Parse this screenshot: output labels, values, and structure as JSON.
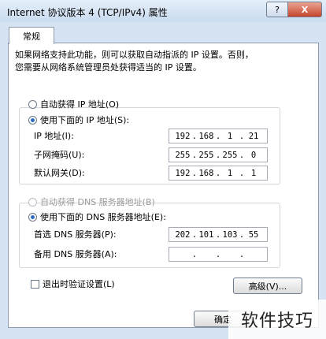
{
  "window": {
    "title": "Internet 协议版本 4 (TCP/IPv4) 属性",
    "help_label": "?",
    "close_label": "X"
  },
  "tabs": {
    "general": "常规"
  },
  "description": {
    "line1": "如果网络支持此功能，则可以获取自动指派的 IP 设置。否则，",
    "line2": "您需要从网络系统管理员处获得适当的 IP 设置。"
  },
  "ip_section": {
    "auto_label": "自动获得 IP 地址(O)",
    "manual_label": "使用下面的 IP 地址(S):",
    "selected": "manual",
    "ip_label": "IP 地址(I):",
    "ip": [
      "192",
      "168",
      "1",
      "21"
    ],
    "mask_label": "子网掩码(U):",
    "mask": [
      "255",
      "255",
      "255",
      "0"
    ],
    "gateway_label": "默认网关(D):",
    "gateway": [
      "192",
      "168",
      "1",
      "1"
    ]
  },
  "dns_section": {
    "auto_label": "自动获得 DNS 服务器地址(B)",
    "manual_label": "使用下面的 DNS 服务器地址(E):",
    "selected": "manual",
    "preferred_label": "首选 DNS 服务器(P):",
    "preferred": [
      "202",
      "101",
      "103",
      "55"
    ],
    "alternate_label": "备用 DNS 服务器(A):",
    "alternate": [
      "",
      "",
      "",
      ""
    ]
  },
  "validate_label": "退出时验证设置(L)",
  "advanced_label": "高级(V)...",
  "ok_label": "确定",
  "watermark": "软件技巧"
}
